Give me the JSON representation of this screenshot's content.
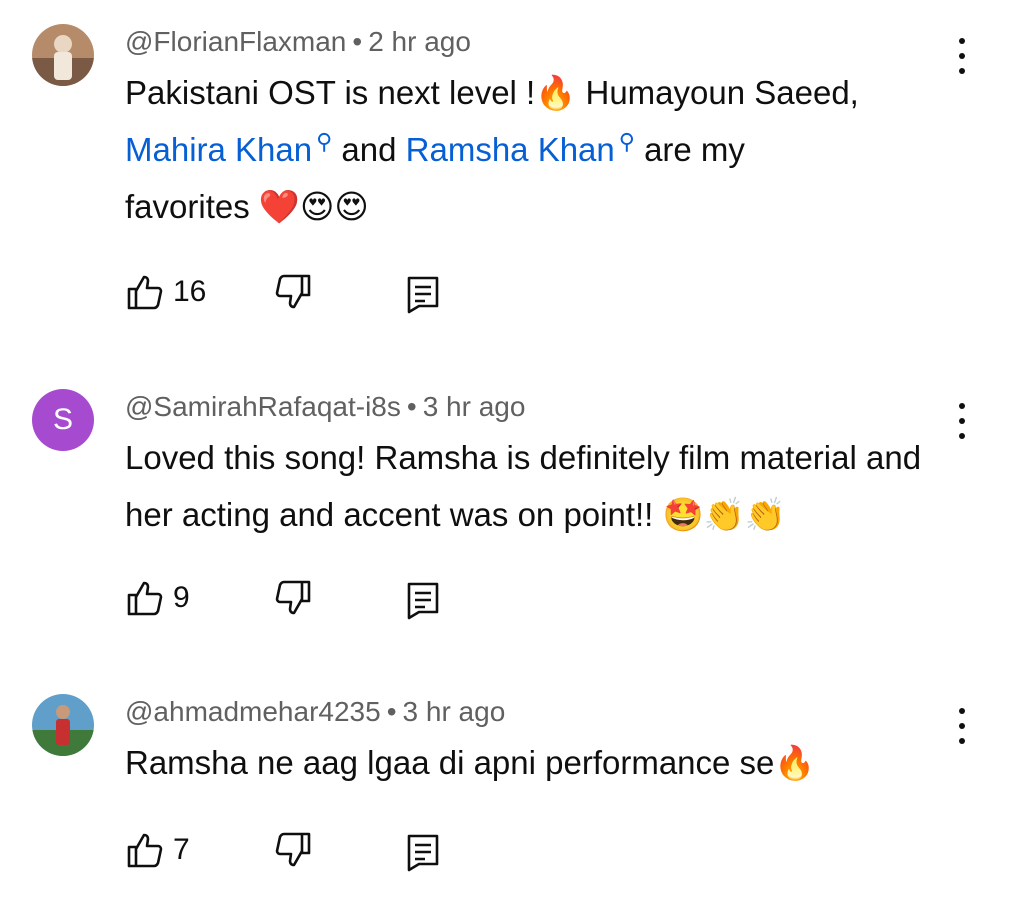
{
  "comments": [
    {
      "author": "@FlorianFlaxman",
      "time": "2 hr ago",
      "text_1": "Pakistani OST is next level !",
      "emoji_fire": "🔥",
      "text_2": " Humayoun Saeed,",
      "mention_1": "Mahira Khan",
      "text_3": "and",
      "mention_2": "Ramsha Khan",
      "text_4": "are my",
      "text_5": "favorites ",
      "emoji_tail": "❤️😍😍",
      "likes": "16"
    },
    {
      "author": "@SamirahRafaqat-i8s",
      "avatar_letter": "S",
      "time": "3 hr ago",
      "text_1": "Loved this song! Ramsha is definitely film material and her acting and accent was on point!! ",
      "emoji_tail": "🤩👏👏",
      "likes": "9"
    },
    {
      "author": "@ahmadmehar4235",
      "time": "3 hr ago",
      "text_1": "Ramsha ne aag lgaa di apni performance se",
      "emoji_tail": "🔥",
      "likes": "7"
    }
  ],
  "meta_separator": "•",
  "icons": {
    "like": "thumb-up-icon",
    "dislike": "thumb-down-icon",
    "reply": "reply-comment-icon",
    "more": "more-vertical-icon",
    "mention": "search-icon"
  },
  "colors": {
    "link": "#065fd4",
    "meta": "#606060",
    "avatar_s": "#a64bd0"
  }
}
